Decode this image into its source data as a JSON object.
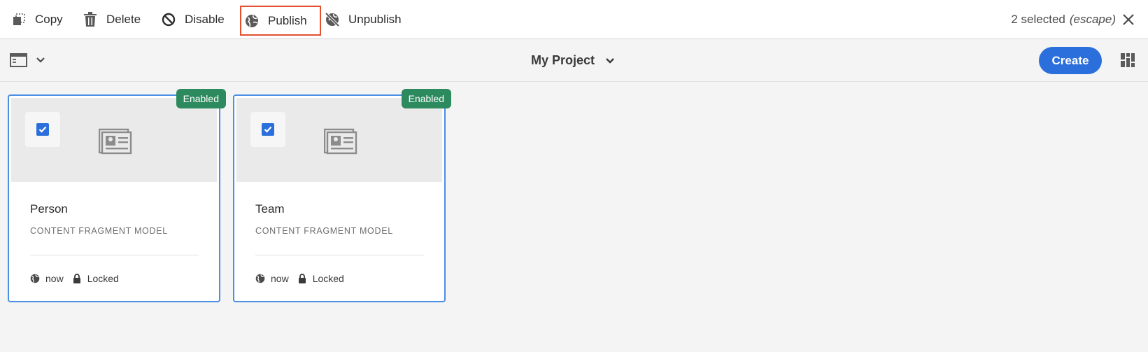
{
  "actionbar": {
    "actions": [
      {
        "label": "Copy",
        "icon": "copy-icon"
      },
      {
        "label": "Delete",
        "icon": "trash-icon"
      },
      {
        "label": "Disable",
        "icon": "disable-icon"
      },
      {
        "label": "Publish",
        "icon": "globe-icon",
        "highlighted": true
      },
      {
        "label": "Unpublish",
        "icon": "globe-unpublish-icon"
      }
    ],
    "selected_count_text": "2 selected",
    "escape_hint": "(escape)"
  },
  "titlebar": {
    "title": "My Project",
    "create_label": "Create"
  },
  "cards": [
    {
      "name": "Person",
      "type": "CONTENT FRAGMENT MODEL",
      "status": "Enabled",
      "modified": "now",
      "lock": "Locked",
      "selected": true
    },
    {
      "name": "Team",
      "type": "CONTENT FRAGMENT MODEL",
      "status": "Enabled",
      "modified": "now",
      "lock": "Locked",
      "selected": true
    }
  ],
  "colors": {
    "accent": "#2a6fdb",
    "enabled_badge": "#2d8a5e",
    "highlight_box": "#e34f2f",
    "card_border": "#4a8ee6"
  }
}
